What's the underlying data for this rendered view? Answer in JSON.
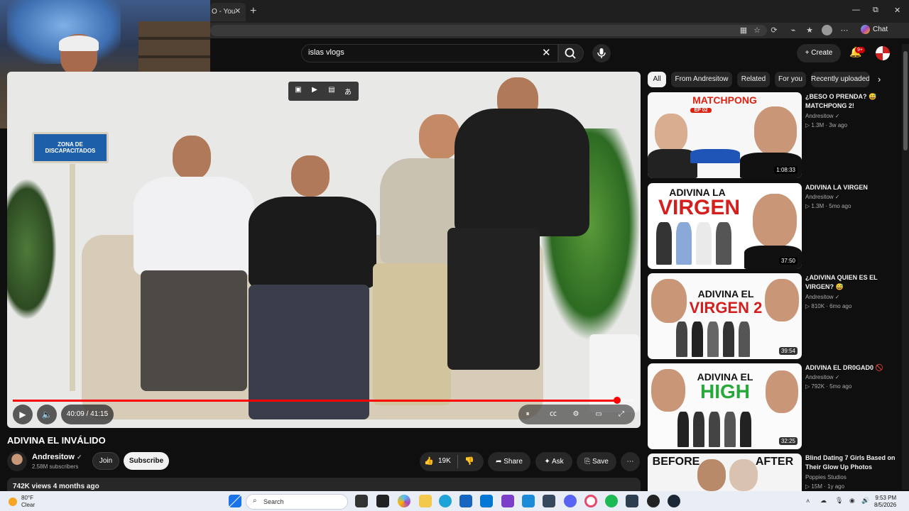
{
  "browser": {
    "tab_title": "O - You",
    "tab_close": "✕",
    "new_tab": "+",
    "chat_label": "Chat",
    "win_min": "—",
    "win_max": "⧉",
    "win_close": "✕"
  },
  "youtube": {
    "search_query": "islas vlogs",
    "create_label": "Create",
    "notif_count": "9+",
    "video": {
      "title": "ADIVINA EL INVÁLIDO",
      "time": "40:09 / 41:15",
      "progress": 0.973,
      "sign_text": "ZONA DE DISCAPACITADOS"
    },
    "channel": {
      "name": "Andresitow",
      "subs": "2.58M subscribers",
      "join": "Join",
      "subscribe": "Subscribe"
    },
    "actions": {
      "likes": "19K",
      "share": "Share",
      "ask": "Ask",
      "save": "Save"
    },
    "views_line": "742K views  4 months ago",
    "chips": [
      "All",
      "From Andresitow",
      "Related",
      "For you",
      "Recently uploaded"
    ],
    "recs": [
      {
        "title": "¿BESO O PRENDA? 😅 MATCHPONG 2!",
        "channel": "Andresitow",
        "meta": "▷ 1.3M · 3w ago",
        "duration": "1:08:33",
        "thumb_text": "MATCHPONG",
        "thumb_sub": "EP 02"
      },
      {
        "title": "ADIVINA LA VIRGEN",
        "channel": "Andresitow",
        "meta": "▷ 1.3M · 5mo ago",
        "duration": "37:50",
        "thumb_text": "ADIVINA LA",
        "thumb_sub": "VIRGEN"
      },
      {
        "title": "¿ADIVINA QUIEN ES EL VIRGEN? 😅",
        "channel": "Andresitow",
        "meta": "▷ 810K · 6mo ago",
        "duration": "39:54",
        "thumb_text": "ADIVINA EL",
        "thumb_sub": "VIRGEN 2"
      },
      {
        "title": "ADIVINA EL DR0GAD0 🚫",
        "channel": "Andresitow",
        "meta": "▷ 792K · 5mo ago",
        "duration": "32:25",
        "thumb_text": "ADIVINA EL",
        "thumb_sub": "HIGH"
      },
      {
        "title": "Blind Dating 7 Girls Based on Their Glow Up Photos",
        "channel": "Poppies Studios",
        "meta": "▷ 15M · 1y ago",
        "duration": "",
        "thumb_text": "BEFORE",
        "thumb_sub": "AFTER"
      }
    ]
  },
  "taskbar": {
    "temp": "80°F",
    "condition": "Clear",
    "search_placeholder": "Search",
    "time": "9:53 PM",
    "date": "8/5/2026"
  },
  "colors": {
    "accent_red": "#ff0000",
    "bg": "#0f0f0f",
    "chip_bg": "#272727"
  }
}
